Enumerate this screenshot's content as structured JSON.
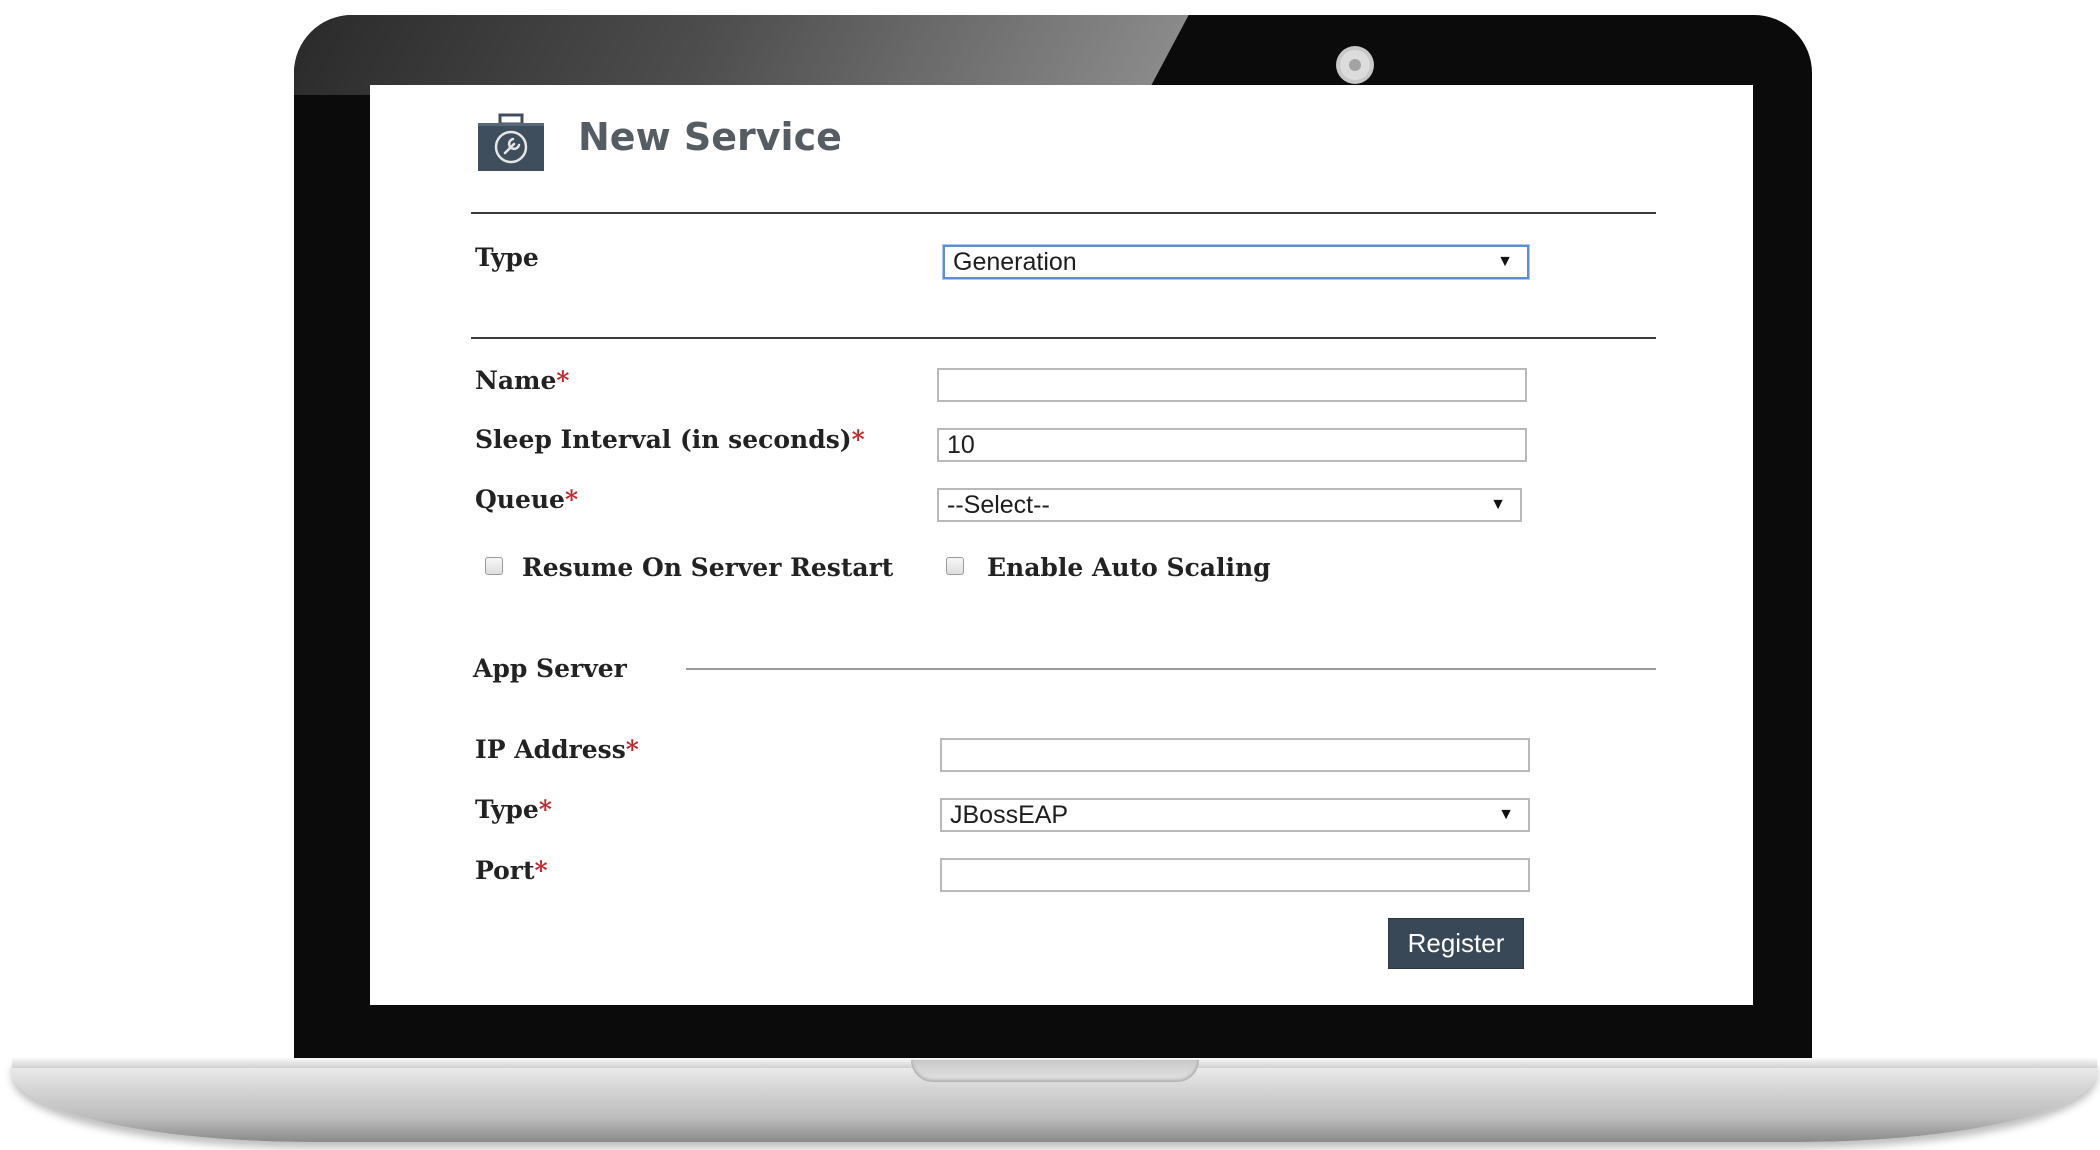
{
  "page": {
    "title": "New Service",
    "icon": "toolbox-wrench-icon"
  },
  "type_section": {
    "label": "Type",
    "value": "Generation"
  },
  "service": {
    "name": {
      "label": "Name",
      "required": "*",
      "value": ""
    },
    "sleep_interval": {
      "label": "Sleep Interval (in seconds)",
      "required": "*",
      "value": "10"
    },
    "queue": {
      "label": "Queue",
      "required": "*",
      "value": "--Select--"
    },
    "resume_on_restart": {
      "label": "Resume On Server Restart",
      "checked": false
    },
    "auto_scaling": {
      "label": "Enable Auto Scaling",
      "checked": false
    }
  },
  "app_server": {
    "heading": "App Server",
    "ip_address": {
      "label": "IP Address",
      "required": "*",
      "value": ""
    },
    "type": {
      "label": "Type",
      "required": "*",
      "value": "JBossEAP"
    },
    "port": {
      "label": "Port",
      "required": "*",
      "value": ""
    }
  },
  "actions": {
    "register": "Register"
  },
  "colors": {
    "button": "#394857",
    "required": "#c1272d",
    "focus_border": "#5a8fd6"
  }
}
